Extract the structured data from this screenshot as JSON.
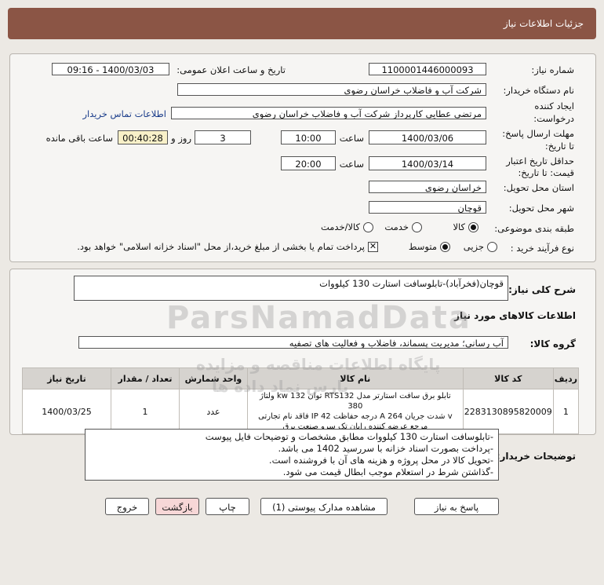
{
  "header": {
    "title": "جزئیات اطلاعات نیاز"
  },
  "form": {
    "need_number_label": "شماره نیاز:",
    "need_number": "1100001446000093",
    "announce_label": "تاریخ و ساعت اعلان عمومی:",
    "announce_value": "1400/03/03 - 09:16",
    "buyer_org_label": "نام دستگاه خریدار:",
    "buyer_org": "شرکت آب و فاضلاب خراسان رضوی",
    "creator_label_1": "ایجاد کننده",
    "creator_label_2": "درخواست:",
    "creator": "مرتضي عطايي کارپرداز شرکت آب و فاضلاب خراسان رضوی",
    "contact_link": "اطلاعات تماس خریدار",
    "send_deadline_label_1": "مهلت ارسال پاسخ:",
    "send_deadline_label_2": "تا تاریخ:",
    "send_date": "1400/03/06",
    "time_label": "ساعت",
    "send_time": "10:00",
    "day_count": "3",
    "day_label": "روز و",
    "remaining_time": "00:40:28",
    "remaining_label": "ساعت باقی مانده",
    "validity_label_1": "حداقل تاریخ اعتبار",
    "validity_label_2": "قیمت: تا تاریخ:",
    "validity_date": "1400/03/14",
    "validity_time": "20:00",
    "province_label": "استان محل تحویل:",
    "province": "خراسان رضوی",
    "city_label": "شهر محل تحویل:",
    "city": "قوچان",
    "category_label": "طبقه بندی موضوعی:",
    "category_options": [
      "کالا",
      "خدمت",
      "کالا/خدمت"
    ],
    "category_selected": 0,
    "process_label": "نوع فرآیند خرید :",
    "process_options": [
      "جزیی",
      "متوسط"
    ],
    "process_selected": 1,
    "payment_note": "پرداخت تمام یا بخشی از مبلغ خرید،از محل \"اسناد خزانه اسلامی\" خواهد بود.",
    "payment_checked": true
  },
  "summary": {
    "label": "شرح کلی نیاز:",
    "value": "قوچان(فخرآباد)-تابلوسافت استارت 130 کیلووات"
  },
  "goods": {
    "section_title": "اطلاعات کالاهای مورد نیاز",
    "group_label": "گروه کالا:",
    "group_value": "آب رسانی؛ مدیریت پسماند، فاضلاب و فعالیت های تصفیه",
    "columns": [
      "ردیف",
      "کد کالا",
      "نام کالا",
      "واحد شمارش",
      "تعداد / مقدار",
      "تاریخ نیاز"
    ],
    "rows": [
      {
        "row": "1",
        "code": "2283130895820009",
        "name_lines": [
          "تابلو برق سافت استارتر مدل RTS132 توان 132 kw ولتاژ 380",
          "v شدت جریان 264 A درجه حفاظت IP 42 فاقد نام تجارتی",
          "مرجع عرضه کننده رایان تک سرو صنعت برق"
        ],
        "unit": "عدد",
        "qty": "1",
        "date": "1400/03/25"
      }
    ]
  },
  "buyer_notes": {
    "label": "توضیحات خریدار:",
    "lines": [
      "-تابلوسافت استارت 130 کیلووات مطابق مشخصات و توضیحات فایل پیوست",
      "-پرداخت بصورت اسناد خزانه با سررسید 1402 می باشد.",
      "-تحویل کالا در محل پروژه و هزینه های آن با فروشنده است.",
      "-گذاشتن شرط در استعلام موجب ابطال قیمت می شود."
    ]
  },
  "buttons": {
    "reply": "پاسخ به نیاز",
    "attachments": "مشاهده مدارک پیوستی (1)",
    "print": "چاپ",
    "back": "بازگشت",
    "exit": "خروج"
  },
  "watermark": {
    "brand": "ParsNamadData",
    "line_fa_1": "پایگاه اطلاعات مناقصه و مزایده",
    "line_fa_2": "پارس نماد داده ها"
  }
}
